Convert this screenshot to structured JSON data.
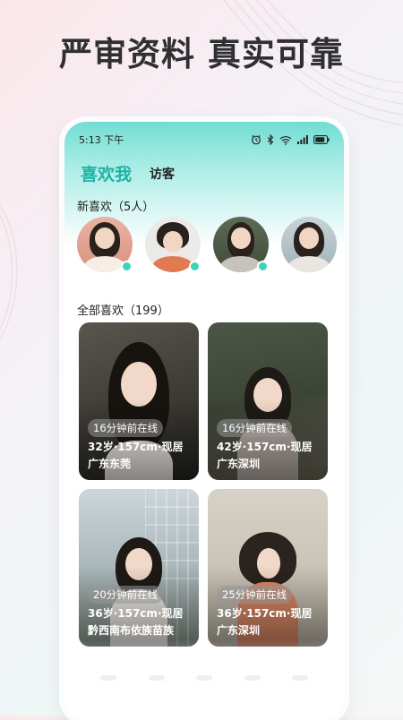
{
  "headline": "严审资料 真实可靠",
  "status": {
    "time": "5:13 下午"
  },
  "tabs": [
    {
      "label": "喜欢我",
      "active": true
    },
    {
      "label": "访客",
      "active": false
    }
  ],
  "new_likes": {
    "label": "新喜欢（5人）",
    "avatars": [
      {
        "online": true
      },
      {
        "online": true
      },
      {
        "online": true
      },
      {
        "online": false
      }
    ]
  },
  "all_likes": {
    "label": "全部喜欢（199）",
    "cards": [
      {
        "online_text": "16分钟前在线",
        "age_height": "32岁·157cm·现居",
        "location": "广东东莞"
      },
      {
        "online_text": "16分钟前在线",
        "age_height": "42岁·157cm·现居",
        "location": "广东深圳"
      },
      {
        "online_text": "20分钟前在线",
        "age_height": "36岁·157cm·现居",
        "location": "黔西南布依族苗族"
      },
      {
        "online_text": "25分钟前在线",
        "age_height": "36岁·157cm·现居",
        "location": "广东深圳"
      }
    ]
  },
  "colors": {
    "accent": "#1db3a6",
    "online_dot": "#3fd3b8",
    "header_gradient": "#72ddd3"
  },
  "icons": [
    "alarm-icon",
    "bluetooth-icon",
    "wifi-icon",
    "signal-icon",
    "battery-icon"
  ]
}
